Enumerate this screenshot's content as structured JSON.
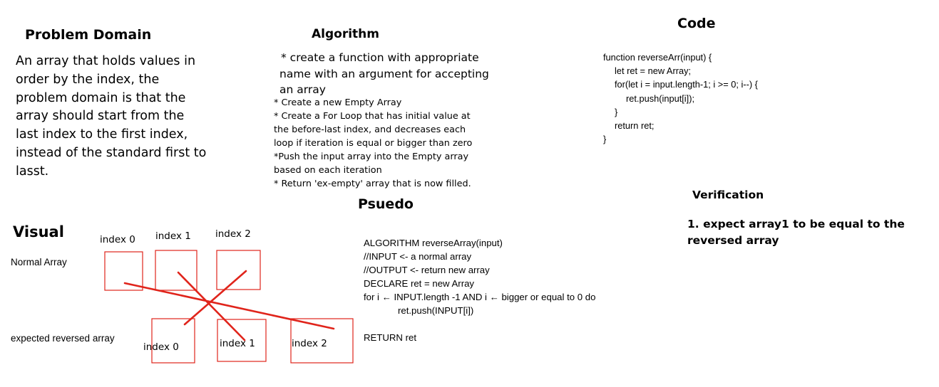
{
  "problem_domain": {
    "title": "Problem Domain",
    "lines": [
      "An array that holds values in",
      "order by the index, the",
      "problem domain is that the",
      "array should start from the",
      "last index to the first index,",
      "instead of the standard first to",
      "lasst."
    ]
  },
  "algorithm": {
    "title": "Algorithm",
    "intro_lines": [
      "* create a function with appropriate",
      "name with an argument for accepting",
      "an array"
    ],
    "step_lines": [
      "* Create a new Empty Array",
      "* Create a For Loop that has initial value at",
      "the before-last index, and decreases each",
      "loop if iteration is equal or bigger than zero",
      "*Push the input array into the Empty array",
      "based on each iteration",
      "* Return 'ex-empty' array that is now filled."
    ]
  },
  "code": {
    "title": "Code",
    "lines": [
      "function reverseArr(input) {",
      "    let ret = new Array;",
      "    for(let i = input.length-1; i >= 0; i--) {",
      "        ret.push(input[i]);",
      "    }",
      "    return ret;",
      "}"
    ]
  },
  "pseudo": {
    "title": "Psuedo",
    "lines": [
      "ALGORITHM reverseArray(input)",
      "//INPUT <- a normal array",
      "//OUTPUT <- return new array",
      "DECLARE ret = new Array",
      "for i ← INPUT.length -1 AND i ← bigger or equal to 0 do",
      "            ret.push(INPUT[i])",
      "",
      "RETURN ret"
    ]
  },
  "verification": {
    "title": "Verification",
    "lines": [
      "1. expect array1 to be equal to the",
      "reversed array"
    ]
  },
  "visual": {
    "title": "Visual",
    "normal_label": "Normal Array",
    "reversed_label": "expected reversed array",
    "top_indices": [
      "index 0",
      "index 1",
      "index 2"
    ],
    "bottom_indices": [
      "index 0",
      "index 1",
      "index 2"
    ],
    "box_color": "#e0241b",
    "line_color": "#e0241b"
  }
}
